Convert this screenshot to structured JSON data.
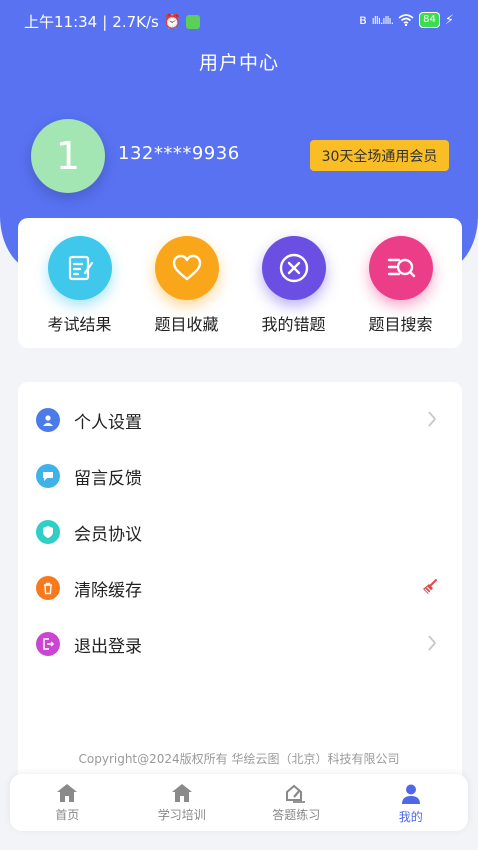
{
  "status_bar": {
    "time": "上午11:34",
    "speed": "2.7K/s",
    "battery": "84",
    "signal": "ıllı.ıllı."
  },
  "header": {
    "title": "用户中心"
  },
  "profile": {
    "avatar_text": "1",
    "phone": "132****9936",
    "membership_badge": "30天全场通用会员"
  },
  "quick_actions": [
    {
      "label": "考试结果",
      "icon": "edit-note-icon",
      "color": "#3fc8ec"
    },
    {
      "label": "题目收藏",
      "icon": "heart-icon",
      "color": "#f9a61a"
    },
    {
      "label": "我的错题",
      "icon": "close-circle-icon",
      "color": "#6a4fe2"
    },
    {
      "label": "题目搜索",
      "icon": "list-search-icon",
      "color": "#ec3d89"
    }
  ],
  "menu": [
    {
      "label": "个人设置",
      "icon": "user-icon",
      "color": "#4a7be8",
      "trailing": "chevron"
    },
    {
      "label": "留言反馈",
      "icon": "chat-icon",
      "color": "#3fb3e9",
      "trailing": ""
    },
    {
      "label": "会员协议",
      "icon": "shield-icon",
      "color": "#2fcfc8",
      "trailing": ""
    },
    {
      "label": "清除缓存",
      "icon": "trash-icon",
      "color": "#f6791c",
      "trailing": "broom"
    },
    {
      "label": "退出登录",
      "icon": "logout-icon",
      "color": "#c945d2",
      "trailing": "chevron"
    }
  ],
  "footer": {
    "copyright": "Copyright@2024版权所有 华绘云图（北京）科技有限公司"
  },
  "tabbar": [
    {
      "label": "首页",
      "icon": "home-icon",
      "active": false
    },
    {
      "label": "学习培训",
      "icon": "home-icon",
      "active": false
    },
    {
      "label": "答题练习",
      "icon": "pen-practice-icon",
      "active": false
    },
    {
      "label": "我的",
      "icon": "person-icon",
      "active": true
    }
  ],
  "colors": {
    "brand": "#5872f2",
    "vip_badge": "#f9be26",
    "active_tab": "#4f68e8"
  }
}
